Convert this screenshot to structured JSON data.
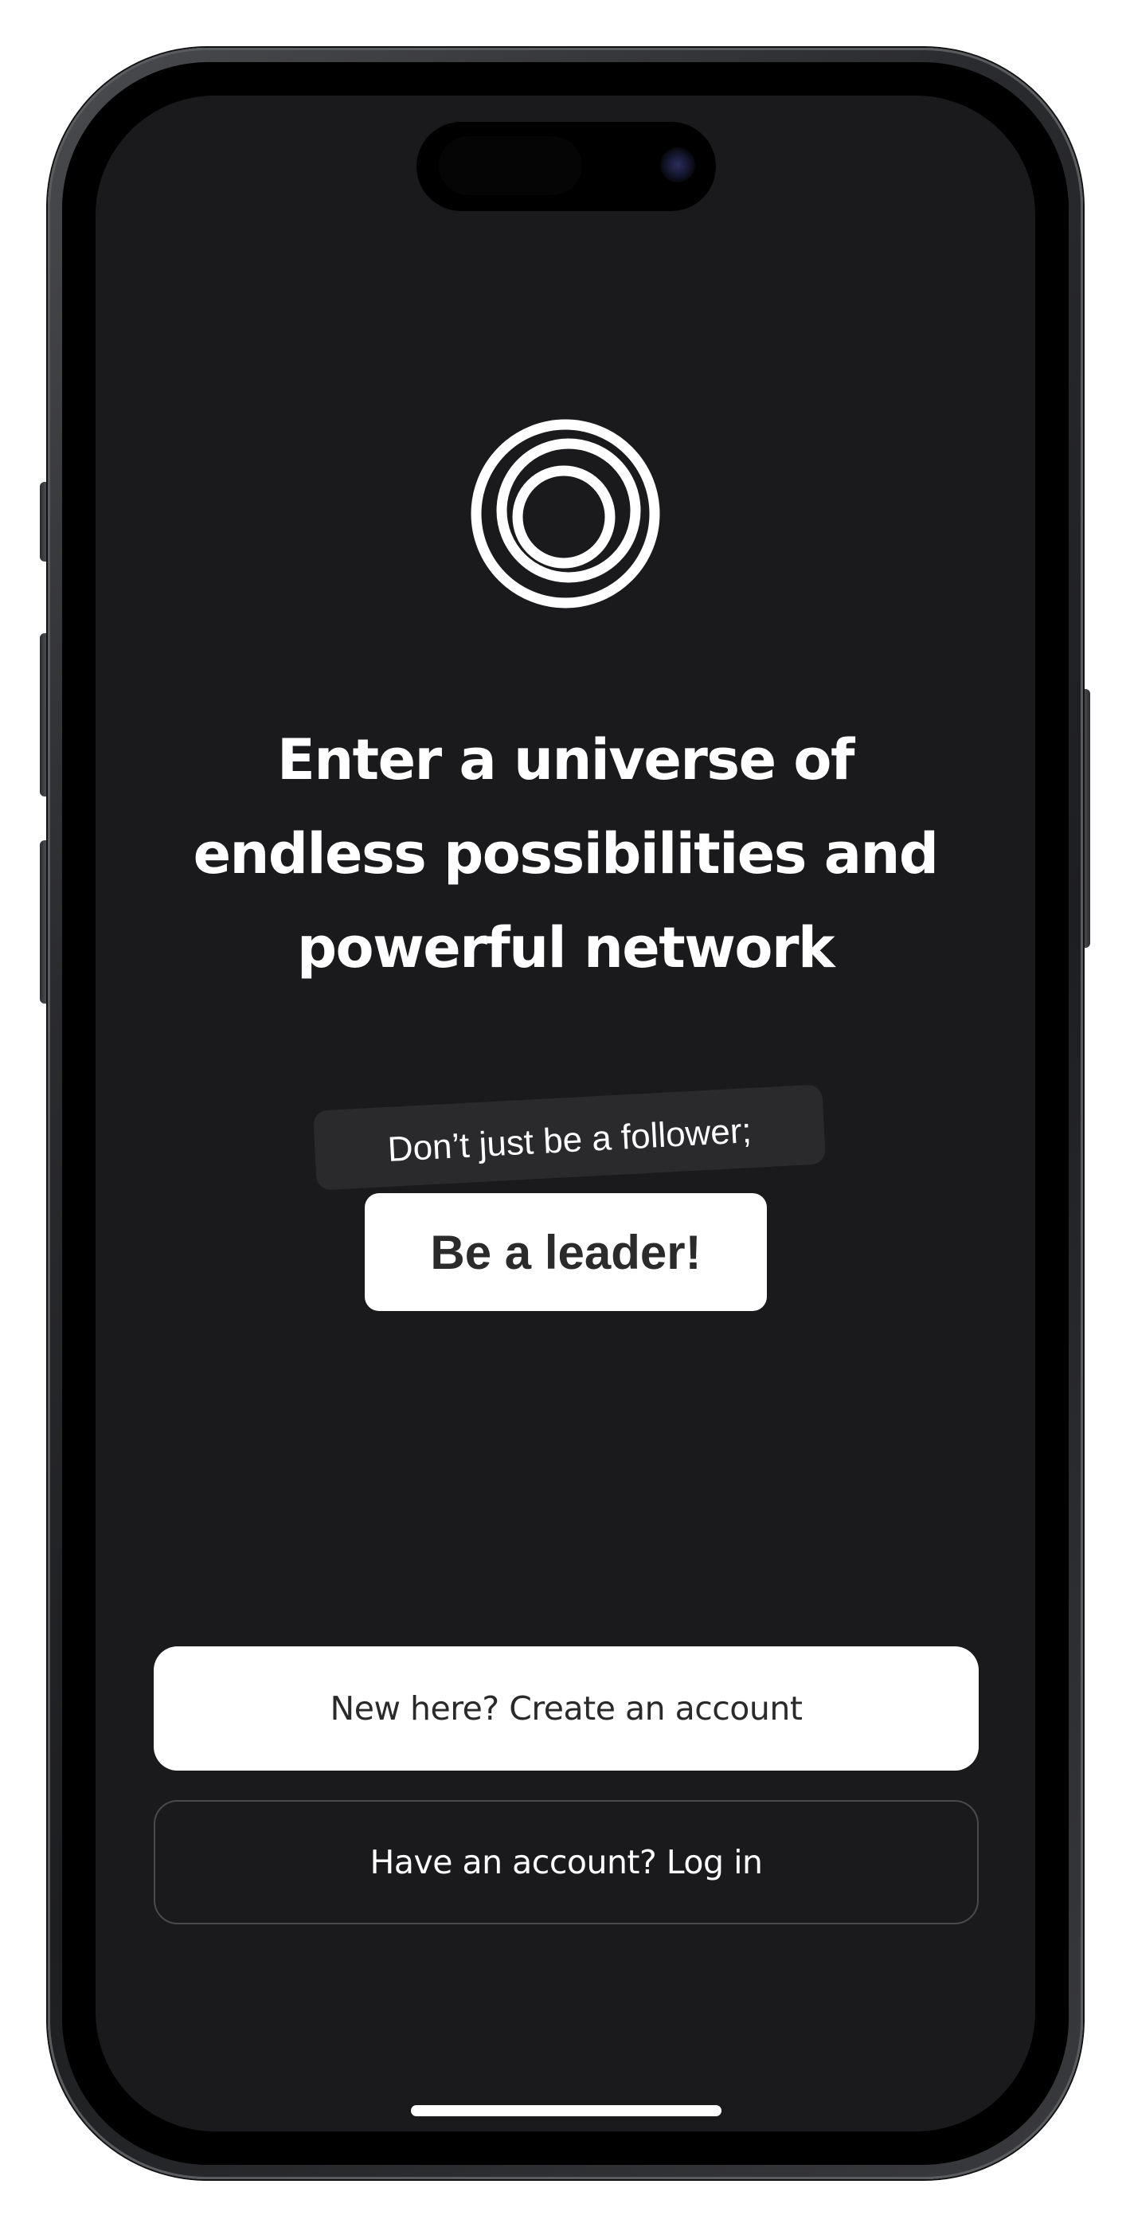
{
  "app": {
    "screen": "welcome"
  },
  "headline": {
    "line1": "Enter a universe of",
    "line2": "endless possibilities and",
    "line3": "powerful network"
  },
  "tagline": {
    "follower_text": "Don’t just be a follower;",
    "leader_text": "Be a leader!"
  },
  "actions": {
    "create_account_label": "New here? Create an account",
    "login_label": "Have an account? Log in"
  },
  "icons": {
    "logo": "concentric-rings-logo-icon"
  },
  "colors": {
    "screen_background": "#1a1a1c",
    "primary_text": "#ffffff",
    "primary_button_bg": "#ffffff",
    "primary_button_text": "#2a2a2a",
    "secondary_button_border": "#4a4a4d",
    "chip_background": "#2a2a2d"
  }
}
